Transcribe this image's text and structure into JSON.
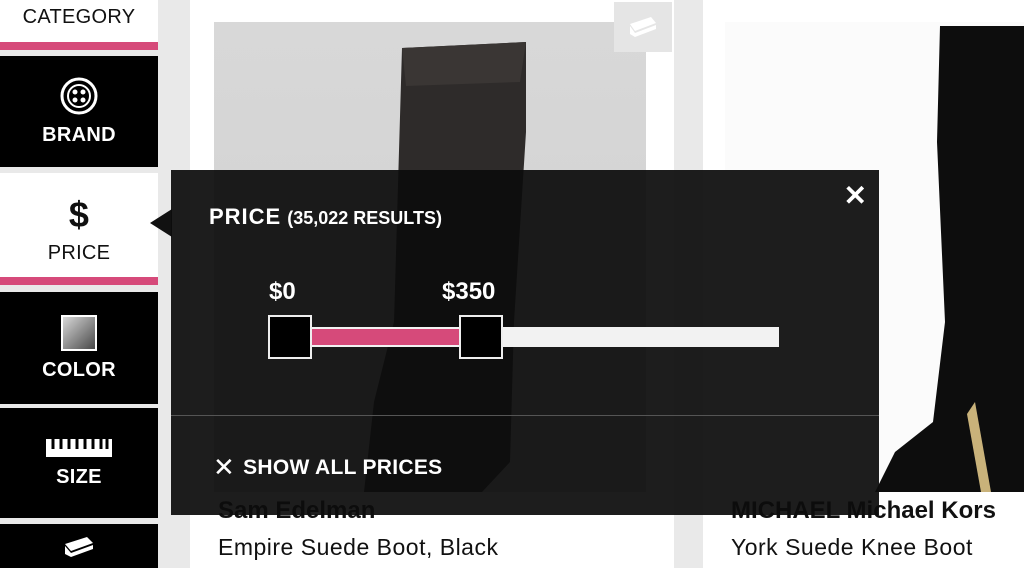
{
  "sidebar": {
    "category": "CATEGORY",
    "brand": "BRAND",
    "price": "PRICE",
    "color": "COLOR",
    "size": "SIZE"
  },
  "products": [
    {
      "brand": "Sam Edelman",
      "name": "Empire Suede Boot, Black"
    },
    {
      "brand": "MICHAEL Michael Kors",
      "name": "York Suede Knee Boot"
    }
  ],
  "price_filter": {
    "title": "PRICE",
    "results": "(35,022 RESULTS)",
    "min_label": "$0",
    "max_label": "$350",
    "reset_label": "SHOW ALL PRICES",
    "close_glyph": "✕",
    "reset_glyph": "✕"
  },
  "colors": {
    "accent": "#d64a7a",
    "overlay": "#0c0c0c"
  }
}
